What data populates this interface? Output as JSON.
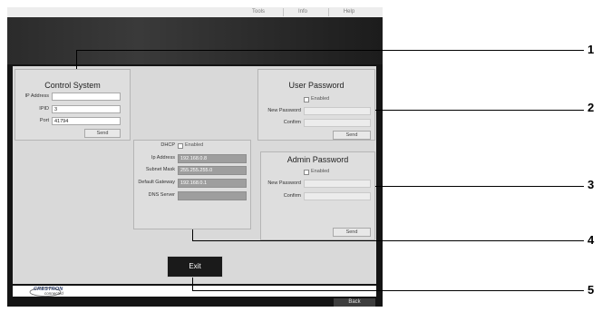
{
  "menu": [
    "Tools",
    "Info",
    "Help"
  ],
  "control_system": {
    "title": "Control System",
    "ip_label": "IP Address",
    "ip_value": "",
    "ipid_label": "IPID",
    "ipid_value": "3",
    "port_label": "Port",
    "port_value": "41794",
    "send_label": "Send"
  },
  "network": {
    "dhcp_label": "DHCP",
    "enabled_label": "Enabled",
    "ip_label": "Ip Address",
    "ip_value": "192.168.0.8",
    "subnet_label": "Subnet Mask",
    "subnet_value": "255.255.255.0",
    "gateway_label": "Default Gateway",
    "gateway_value": "192.168.0.1",
    "dns_label": "DNS Server",
    "dns_value": ""
  },
  "user_password": {
    "title": "User Password",
    "enabled_label": "Enabled",
    "new_label": "New Password",
    "confirm_label": "Confirm",
    "send_label": "Send"
  },
  "admin_password": {
    "title": "Admin Password",
    "enabled_label": "Enabled",
    "new_label": "New Password",
    "confirm_label": "Confirm",
    "send_label": "Send"
  },
  "exit_label": "Exit",
  "logo": {
    "brand": "CRESTRON",
    "sub": "connected"
  },
  "back_label": "Back",
  "callouts": [
    "1",
    "2",
    "3",
    "4",
    "5"
  ]
}
